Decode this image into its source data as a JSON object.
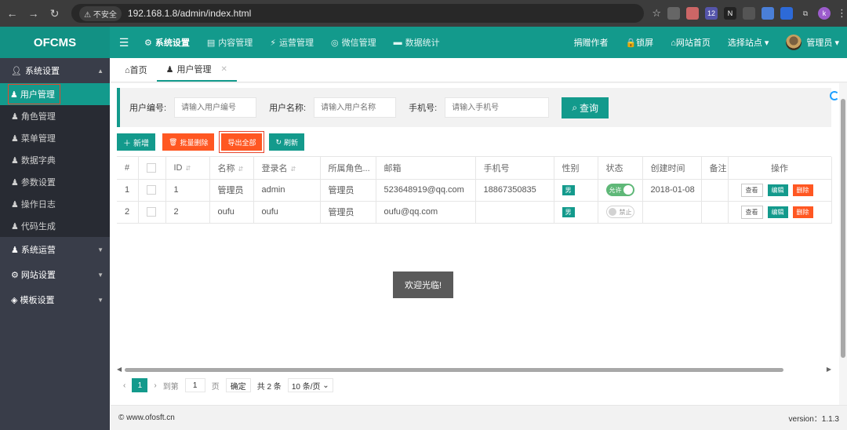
{
  "browser": {
    "insecure_label": "不安全",
    "url": "192.168.1.8/admin/index.html",
    "ext_badge": "12",
    "profile": "k"
  },
  "app": {
    "logo": "OFCMS",
    "top_menu": [
      {
        "icon": "⚙",
        "label": "系统设置"
      },
      {
        "icon": "▤",
        "label": "内容管理"
      },
      {
        "icon": "⚡",
        "label": "运营管理"
      },
      {
        "icon": "◎",
        "label": "微信管理"
      },
      {
        "icon": "▬",
        "label": "数据统计"
      }
    ],
    "top_right": {
      "donate": "捐赠作者",
      "lock": "🔒锁屏",
      "home": "⌂网站首页",
      "site_select": "选择站点 ▾",
      "admin": "管理员 ▾"
    }
  },
  "sidebar": {
    "group_system": "系统设置",
    "items": [
      "用户管理",
      "角色管理",
      "菜单管理",
      "数据字典",
      "参数设置",
      "操作日志",
      "代码生成"
    ],
    "group_ops": "系统运营",
    "group_site": "网站设置",
    "group_template": "模板设置"
  },
  "tabs": {
    "home": "⌂首页",
    "user": "用户管理"
  },
  "search": {
    "user_no_label": "用户编号:",
    "user_no_placeholder": "请输入用户编号",
    "user_name_label": "用户名称:",
    "user_name_placeholder": "请输入用户名称",
    "phone_label": "手机号:",
    "phone_placeholder": "请输入手机号",
    "query_button": "查询"
  },
  "toolbar": {
    "add": "新增",
    "batch_delete": "批量删除",
    "export_all": "导出全部",
    "refresh": "刷新"
  },
  "table": {
    "headers": [
      "#",
      "",
      "ID",
      "名称",
      "登录名",
      "所属角色...",
      "邮箱",
      "手机号",
      "性别",
      "状态",
      "创建时间",
      "备注",
      "操作"
    ],
    "rows": [
      {
        "idx": "1",
        "id": "1",
        "name": "管理员",
        "login": "admin",
        "role": "管理员",
        "email": "523648919@qq.com",
        "phone": "18867350835",
        "sex": "男",
        "status": "允许",
        "created": "2018-01-08",
        "remark": ""
      },
      {
        "idx": "2",
        "id": "2",
        "name": "oufu",
        "login": "oufu",
        "role": "管理员",
        "email": "oufu@qq.com",
        "phone": "",
        "sex": "男",
        "status": "禁止",
        "created": "",
        "remark": ""
      }
    ],
    "actions": {
      "view": "查看",
      "edit": "编辑",
      "delete": "删除"
    }
  },
  "toast": "欢迎光临!",
  "pager": {
    "current": "1",
    "goto_label": "到第",
    "goto_value": "1",
    "page_unit": "页",
    "confirm": "确定",
    "total": "共 2 条",
    "page_size": "10 条/页"
  },
  "footer": {
    "copyright": "© www.ofosft.cn",
    "version": "version：1.1.3"
  }
}
